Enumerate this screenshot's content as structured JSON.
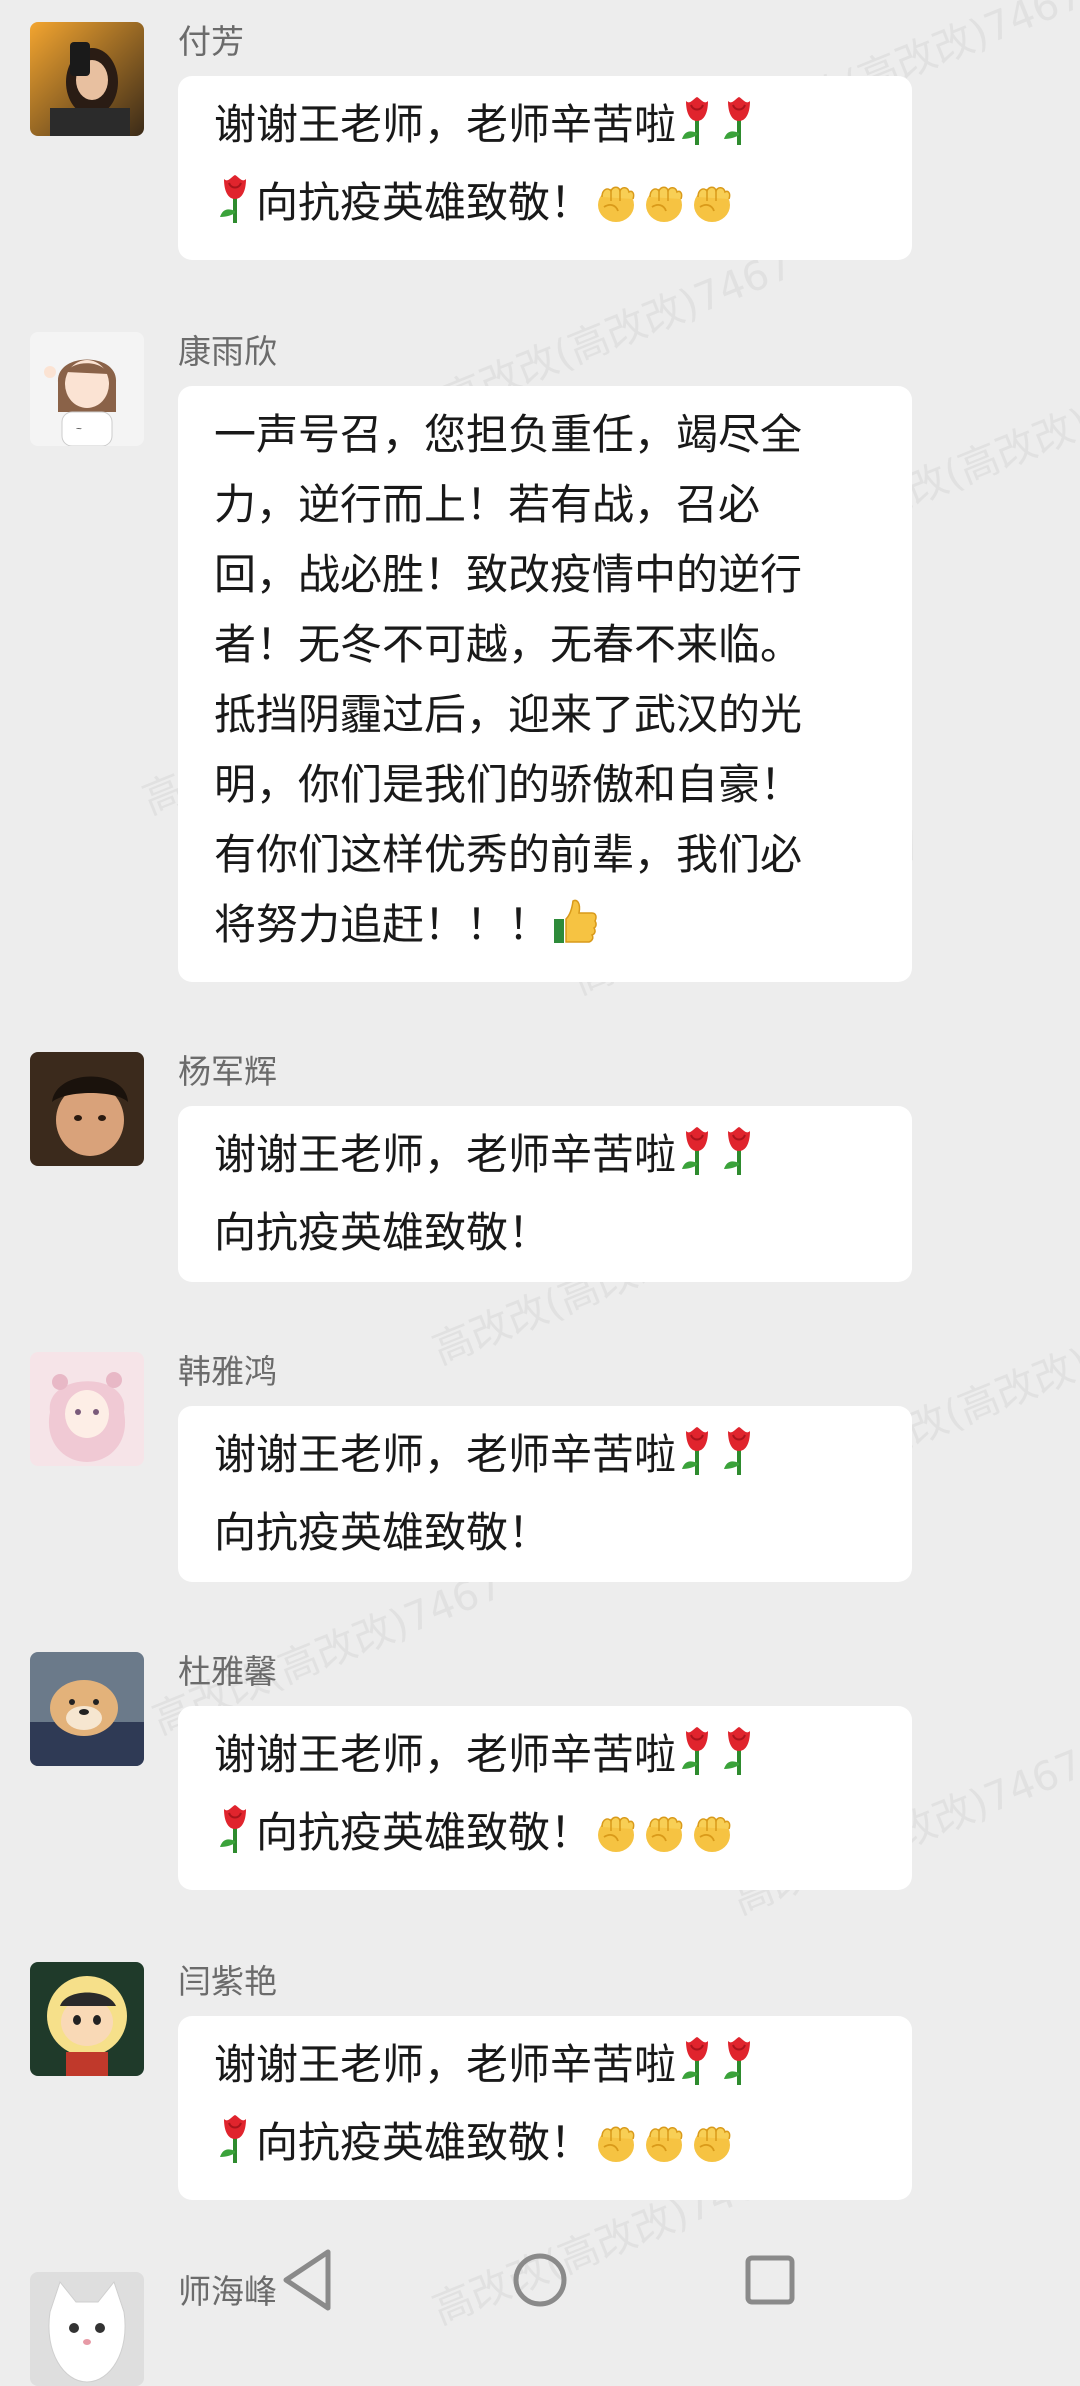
{
  "messages": [
    {
      "sender": "付芳",
      "avatar_icon": "selfie-avatar",
      "lines": [
        [
          {
            "t": "text",
            "v": "谢谢王老师，老师辛苦啦"
          },
          {
            "t": "icon",
            "v": "rose-emoji"
          },
          {
            "t": "icon",
            "v": "rose-emoji"
          }
        ],
        [
          {
            "t": "icon",
            "v": "rose-emoji"
          },
          {
            "t": "text",
            "v": "向抗疫英雄致敬！"
          },
          {
            "t": "icon",
            "v": "fist-emoji"
          },
          {
            "t": "icon",
            "v": "fist-emoji"
          },
          {
            "t": "icon",
            "v": "fist-emoji"
          }
        ]
      ]
    },
    {
      "sender": "康雨欣",
      "avatar_icon": "cartoon-girl-avatar",
      "lines": [
        [
          {
            "t": "text",
            "v": "一声号召，您担负重任，竭尽全"
          }
        ],
        [
          {
            "t": "text",
            "v": "力，逆行而上！若有战，召必"
          }
        ],
        [
          {
            "t": "text",
            "v": "回，战必胜！致改疫情中的逆行"
          }
        ],
        [
          {
            "t": "text",
            "v": "者！无冬不可越，无春不来临。"
          }
        ],
        [
          {
            "t": "text",
            "v": "抵挡阴霾过后，迎来了武汉的光"
          }
        ],
        [
          {
            "t": "text",
            "v": "明，你们是我们的骄傲和自豪！"
          }
        ],
        [
          {
            "t": "text",
            "v": "有你们这样优秀的前辈，我们必"
          }
        ],
        [
          {
            "t": "text",
            "v": "将努力追赶！！！"
          },
          {
            "t": "icon",
            "v": "thumbs-up-emoji"
          }
        ]
      ]
    },
    {
      "sender": "杨军辉",
      "avatar_icon": "child-photo-avatar",
      "lines": [
        [
          {
            "t": "text",
            "v": "谢谢王老师，老师辛苦啦"
          },
          {
            "t": "icon",
            "v": "rose-emoji"
          },
          {
            "t": "icon",
            "v": "rose-emoji"
          }
        ],
        [
          {
            "t": "text",
            "v": "向抗疫英雄致敬！"
          }
        ]
      ]
    },
    {
      "sender": "韩雅鸿",
      "avatar_icon": "anime-girl-avatar",
      "lines": [
        [
          {
            "t": "text",
            "v": "谢谢王老师，老师辛苦啦"
          },
          {
            "t": "icon",
            "v": "rose-emoji"
          },
          {
            "t": "icon",
            "v": "rose-emoji"
          }
        ],
        [
          {
            "t": "text",
            "v": "向抗疫英雄致敬！"
          }
        ]
      ]
    },
    {
      "sender": "杜雅馨",
      "avatar_icon": "dog-photo-avatar",
      "lines": [
        [
          {
            "t": "text",
            "v": "谢谢王老师，老师辛苦啦"
          },
          {
            "t": "icon",
            "v": "rose-emoji"
          },
          {
            "t": "icon",
            "v": "rose-emoji"
          }
        ],
        [
          {
            "t": "icon",
            "v": "rose-emoji"
          },
          {
            "t": "text",
            "v": "向抗疫英雄致敬！"
          },
          {
            "t": "icon",
            "v": "fist-emoji"
          },
          {
            "t": "icon",
            "v": "fist-emoji"
          },
          {
            "t": "icon",
            "v": "fist-emoji"
          }
        ]
      ]
    },
    {
      "sender": "闫紫艳",
      "avatar_icon": "cartoon-boy-avatar",
      "lines": [
        [
          {
            "t": "text",
            "v": "谢谢王老师，老师辛苦啦"
          },
          {
            "t": "icon",
            "v": "rose-emoji"
          },
          {
            "t": "icon",
            "v": "rose-emoji"
          }
        ],
        [
          {
            "t": "icon",
            "v": "rose-emoji"
          },
          {
            "t": "text",
            "v": "向抗疫英雄致敬！"
          },
          {
            "t": "icon",
            "v": "fist-emoji"
          },
          {
            "t": "icon",
            "v": "fist-emoji"
          },
          {
            "t": "icon",
            "v": "fist-emoji"
          }
        ]
      ]
    },
    {
      "sender": "师海峰",
      "avatar_icon": "cat-photo-avatar",
      "lines": []
    }
  ],
  "watermark_text": "高改改(高改改)7467",
  "navbar": {
    "back_icon": "back-triangle-icon",
    "home_icon": "home-circle-icon",
    "recents_icon": "recents-square-icon"
  },
  "colors": {
    "background": "#ededed",
    "bubble": "#ffffff",
    "text": "#191919",
    "sender": "#6b6b6b"
  }
}
